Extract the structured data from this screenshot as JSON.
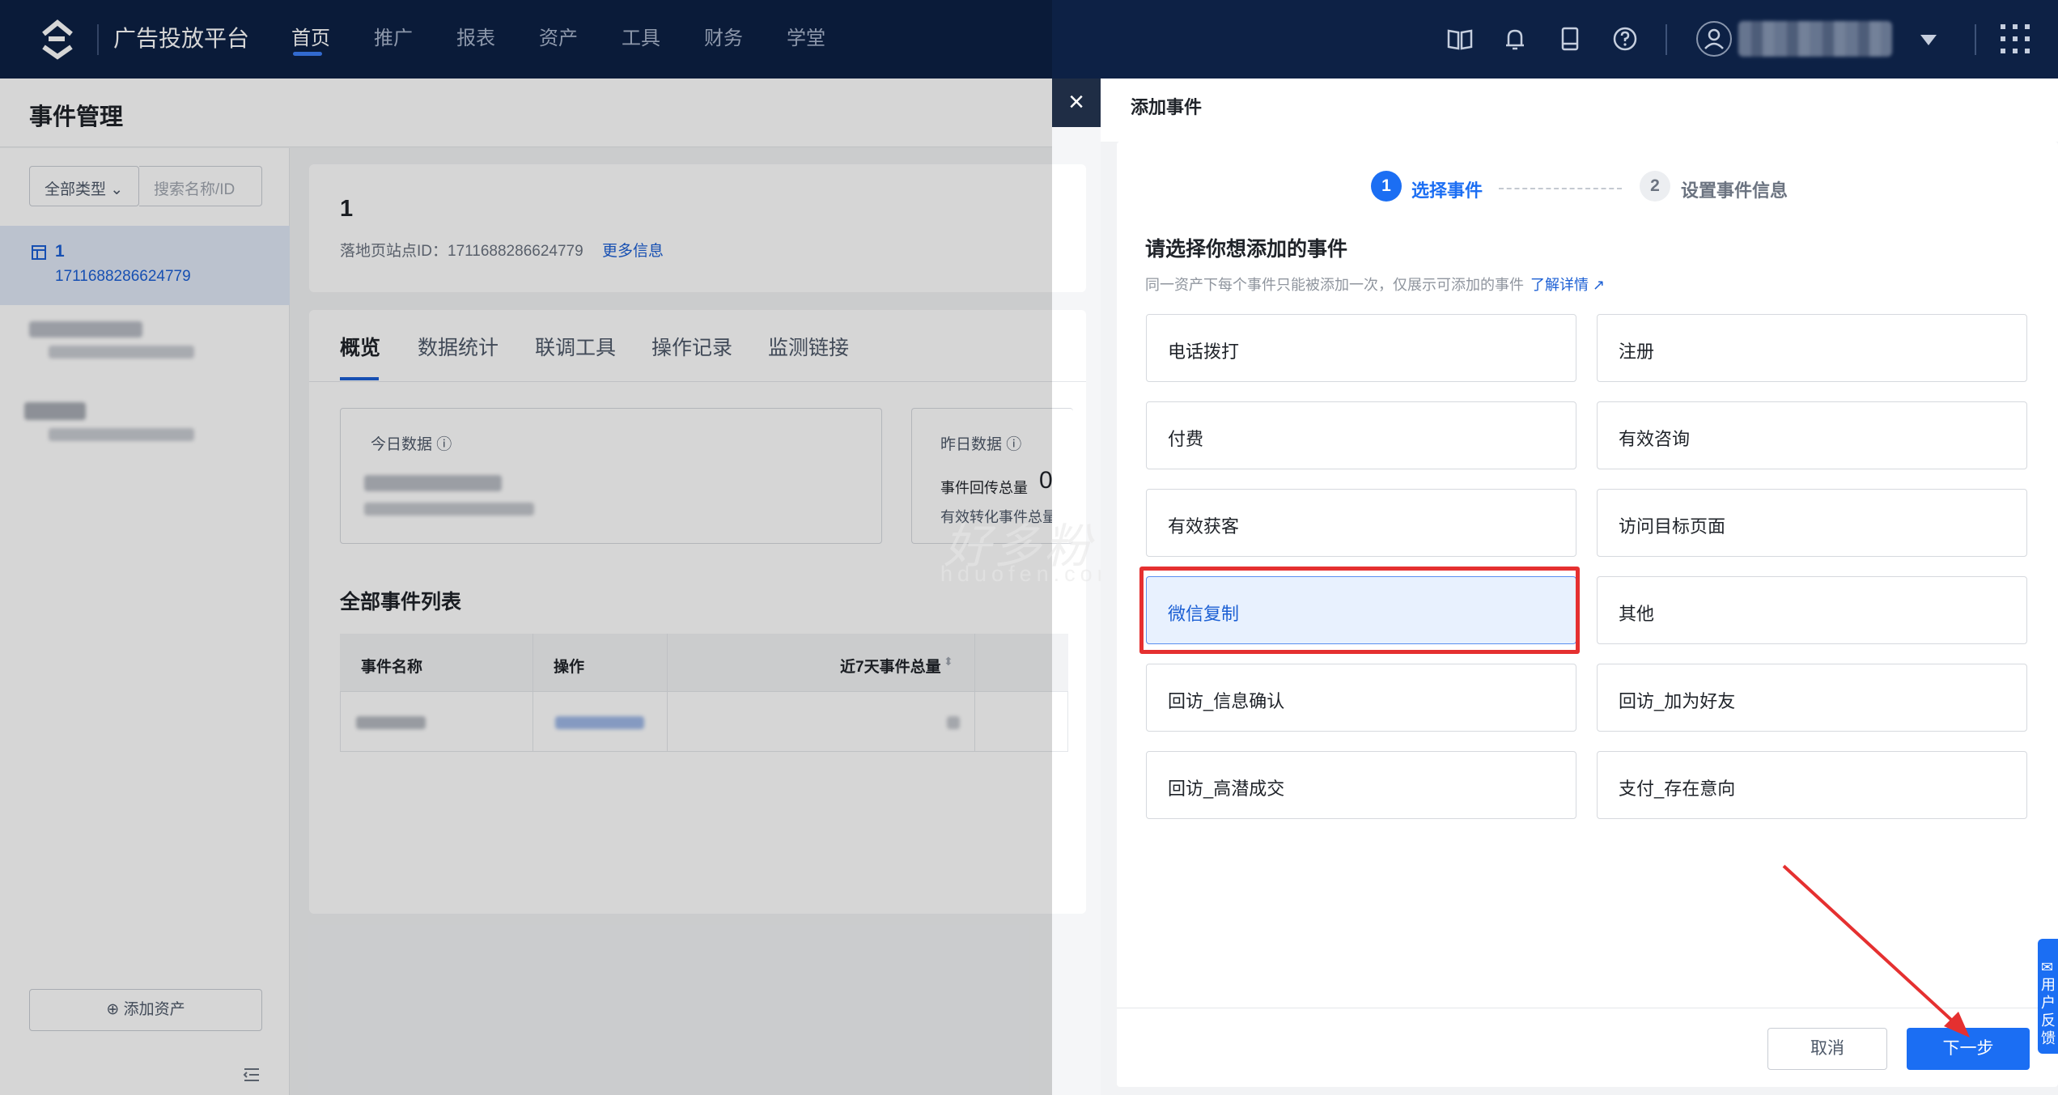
{
  "topbar": {
    "brand": "广告投放平台",
    "nav": [
      "首页",
      "推广",
      "报表",
      "资产",
      "工具",
      "财务",
      "学堂"
    ],
    "active_nav": "首页",
    "icons": [
      "book-icon",
      "bell-icon",
      "tablet-icon",
      "help-icon",
      "user-icon",
      "apps-grid-icon"
    ]
  },
  "page": {
    "title": "事件管理",
    "filter_type": "全部类型",
    "search_placeholder": "搜索名称/ID",
    "asset_selected": {
      "name": "1",
      "id": "1711688286624779"
    },
    "add_asset": "添加资产"
  },
  "asset_card": {
    "title": "1",
    "site_label": "落地页站点ID：1711688286624779",
    "more": "更多信息"
  },
  "tabs": [
    "概览",
    "数据统计",
    "联调工具",
    "操作记录",
    "监测链接"
  ],
  "stats": {
    "today_label": "今日数据",
    "yesterday_label": "昨日数据",
    "event_total_label": "事件回传总量",
    "event_total_value": "0",
    "conversion_label": "有效转化事件总量"
  },
  "event_list": {
    "title": "全部事件列表",
    "columns": [
      "事件名称",
      "操作",
      "近7天事件总量"
    ]
  },
  "drawer": {
    "title": "添加事件",
    "close": "×",
    "steps": [
      {
        "num": "1",
        "label": "选择事件"
      },
      {
        "num": "2",
        "label": "设置事件信息"
      }
    ],
    "question": "请选择你想添加的事件",
    "hint": "同一资产下每个事件只能被添加一次，仅展示可添加的事件",
    "learn_more": "了解详情",
    "options": [
      "电话拨打",
      "注册",
      "付费",
      "有效咨询",
      "有效获客",
      "访问目标页面",
      "微信复制",
      "其他",
      "回访_信息确认",
      "回访_加为好友",
      "回访_高潜成交",
      "支付_存在意向"
    ],
    "selected_option": "微信复制",
    "cancel": "取消",
    "next": "下一步"
  },
  "feedback_tab": "用户反馈",
  "watermark": {
    "cn": "好多粉",
    "en": "hduofen.com"
  },
  "colors": {
    "topbar": "#0d2145",
    "primary": "#1b6ef3",
    "highlight": "#e53030"
  }
}
